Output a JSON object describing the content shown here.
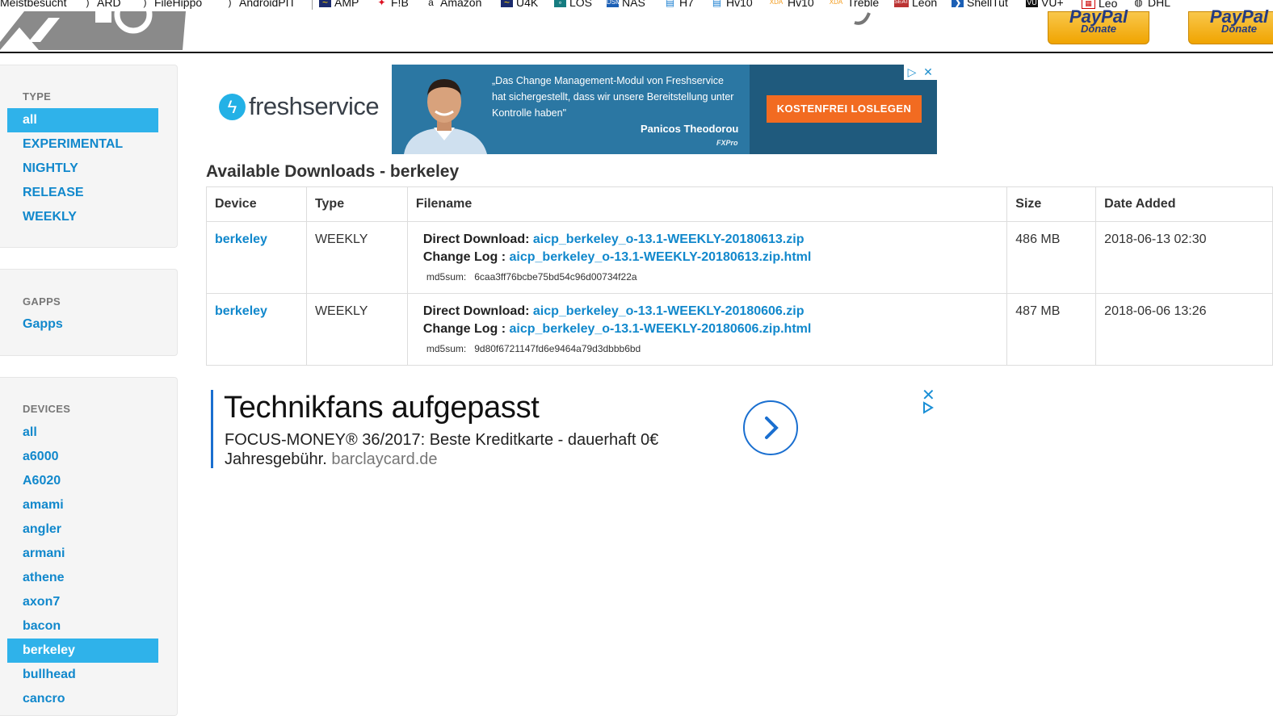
{
  "bookmarks": [
    {
      "label": "Meistbesucht",
      "icon": "none"
    },
    {
      "label": "ARD",
      "icon": "rss-icon"
    },
    {
      "label": "FileHippo",
      "icon": "rss-icon"
    },
    {
      "label": "AndroidPIT",
      "icon": "rss-icon"
    },
    {
      "label": "AMP",
      "icon": "amp-icon"
    },
    {
      "label": "F!B",
      "icon": "fib-icon"
    },
    {
      "label": "Amazon",
      "icon": "amazon-icon"
    },
    {
      "label": "U4K",
      "icon": "u4k-icon"
    },
    {
      "label": "LOS",
      "icon": "los-icon"
    },
    {
      "label": "NAS",
      "icon": "nas-icon"
    },
    {
      "label": "H7",
      "icon": "h7-icon"
    },
    {
      "label": "Hv10",
      "icon": "hv10-icon"
    },
    {
      "label": "Hv10",
      "icon": "xda-icon"
    },
    {
      "label": "Treble",
      "icon": "xda-icon"
    },
    {
      "label": "Leon",
      "icon": "leon-icon"
    },
    {
      "label": "ShellTut",
      "icon": "shelltut-icon"
    },
    {
      "label": "VU+",
      "icon": "vu-icon"
    },
    {
      "label": "Leo",
      "icon": "leo-icon"
    },
    {
      "label": "DHL",
      "icon": "globe-icon"
    }
  ],
  "header": {
    "paypal_word": "PayPal",
    "donate_label": "Donate"
  },
  "sidebar": {
    "type_title": "TYPE",
    "type_items": [
      "all",
      "EXPERIMENTAL",
      "NIGHTLY",
      "RELEASE",
      "WEEKLY"
    ],
    "type_active": "all",
    "gapps_title": "GAPPS",
    "gapps_items": [
      "Gapps"
    ],
    "devices_title": "DEVICES",
    "device_items": [
      "all",
      "a6000",
      "A6020",
      "amami",
      "angler",
      "armani",
      "athene",
      "axon7",
      "bacon",
      "berkeley",
      "bullhead",
      "cancro"
    ],
    "device_active": "berkeley"
  },
  "fs_ad": {
    "brand": "freshservice",
    "quote": "„Das Change Management-Modul von Freshservice hat sichergestellt, dass wir unsere Bereitstellung unter Kontrolle haben\"",
    "person": "Panicos Theodorou",
    "company": "FXPro",
    "cta": "KOSTENFREI LOSLEGEN"
  },
  "main": {
    "title": "Available Downloads - berkeley",
    "columns": [
      "Device",
      "Type",
      "Filename",
      "Size",
      "Date Added"
    ],
    "direct_label": "Direct Download",
    "changelog_label": "Change Log",
    "md5_label": "md5sum:",
    "rows": [
      {
        "device": "berkeley",
        "type": "WEEKLY",
        "file": "aicp_berkeley_o-13.1-WEEKLY-20180613.zip",
        "changelog": "aicp_berkeley_o-13.1-WEEKLY-20180613.zip.html",
        "md5": "6caa3ff76bcbe75bd54c96d00734f22a",
        "size": "486 MB",
        "date": "2018-06-13 02:30"
      },
      {
        "device": "berkeley",
        "type": "WEEKLY",
        "file": "aicp_berkeley_o-13.1-WEEKLY-20180606.zip",
        "changelog": "aicp_berkeley_o-13.1-WEEKLY-20180606.zip.html",
        "md5": "9d80f6721147fd6e9464a79d3dbbb6bd",
        "size": "487 MB",
        "date": "2018-06-06 13:26"
      }
    ]
  },
  "bc_ad": {
    "title": "Technikfans aufgepasst",
    "line1": "FOCUS-MONEY® 36/2017: Beste Kreditkarte - dauerhaft 0€",
    "line2": "Jahresgebühr.",
    "domain": "barclaycard.de"
  },
  "colors": {
    "link": "#1188cc",
    "active_bg": "#2fb2ea",
    "cta": "#f26b21",
    "ad_blue": "#1a6fd0"
  }
}
